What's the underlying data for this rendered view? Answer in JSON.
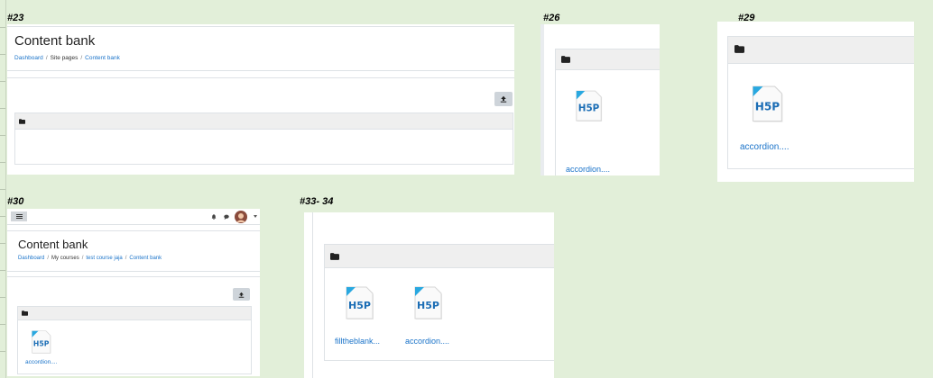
{
  "labels": {
    "s23": "#23",
    "s26": "#26",
    "s29": "#29",
    "s30": "#30",
    "s33": "#33- 34"
  },
  "shot23": {
    "title": "Content bank",
    "breadcrumb": [
      "Dashboard",
      "Site pages",
      "Content bank"
    ]
  },
  "shot26": {
    "file": "accordion...."
  },
  "shot29": {
    "file": "accordion...."
  },
  "shot30": {
    "title": "Content bank",
    "breadcrumb": [
      "Dashboard",
      "My courses",
      "test course jaja",
      "Content bank"
    ],
    "file": "accordion...."
  },
  "shot33": {
    "files": [
      "filltheblank...",
      "accordion...."
    ]
  },
  "colors": {
    "background": "#e2efd9",
    "link": "#1a73c9",
    "h5p_blue": "#1b6db5",
    "h5p_cyan": "#29a8e0"
  },
  "icons": [
    "folder-icon",
    "upload-icon",
    "h5p-icon",
    "menu-icon",
    "bell-icon",
    "chat-icon",
    "avatar"
  ]
}
